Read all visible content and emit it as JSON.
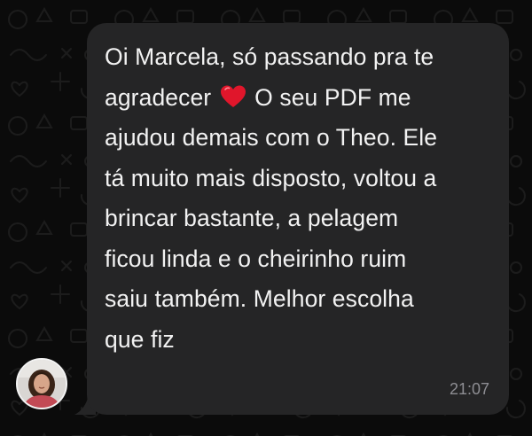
{
  "wallpaper": {
    "pattern_icon": "doodle-pattern-icon",
    "color": "#0b0b0b"
  },
  "message": {
    "sender_avatar_icon": "contact-avatar-icon",
    "bubble_color": "#252526",
    "lines": [
      "Oi Marcela, só passando pra te",
      "agradecer",
      "O seu PDF me",
      "ajudou demais com o Theo. Ele",
      "tá muito mais disposto, voltou a",
      "brincar bastante, a pelagem",
      "ficou linda e o cheirinho ruim",
      "saiu também. Melhor escolha",
      "que fiz"
    ],
    "emoji_icon": "red-heart-icon",
    "emoji_color": "#e0162b",
    "time": "21:07"
  }
}
